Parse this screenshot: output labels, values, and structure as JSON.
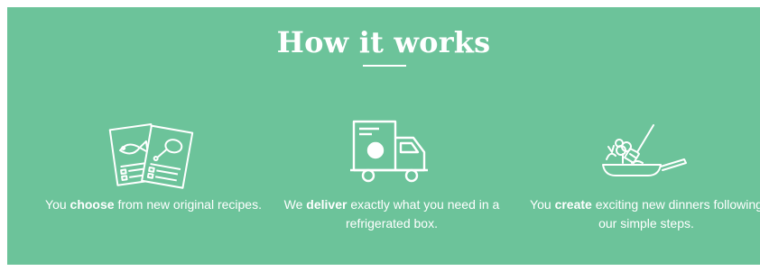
{
  "section": {
    "title": "How it works",
    "background_color": "#6cc39a",
    "text_color": "#ffffff"
  },
  "steps": [
    {
      "icon": "recipe-cards-icon",
      "pre": "You ",
      "emphasis": "choose",
      "post": " from new original recipes."
    },
    {
      "icon": "delivery-truck-icon",
      "pre": "We ",
      "emphasis": "deliver",
      "post": " exactly what you need in a refrigerated box."
    },
    {
      "icon": "cooking-pan-icon",
      "pre": "You ",
      "emphasis": "create",
      "post": " exciting new dinners following our simple steps."
    }
  ]
}
